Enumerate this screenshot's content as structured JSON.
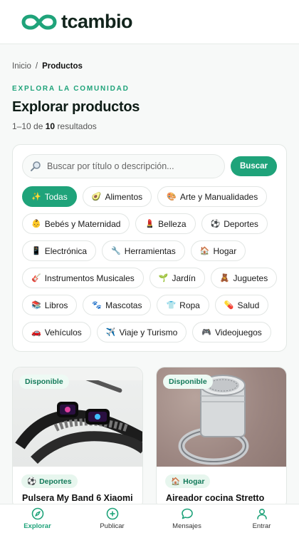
{
  "brand": {
    "name": "tcambio",
    "color": "#1fa37a"
  },
  "breadcrumb": {
    "home": "Inicio",
    "separator": "/",
    "current": "Productos"
  },
  "header": {
    "kicker": "EXPLORA LA COMUNIDAD",
    "title": "Explorar productos",
    "results_range": "1–10 de",
    "results_count": "10",
    "results_suffix": "resultados"
  },
  "search": {
    "placeholder": "Buscar por título o descripción...",
    "value": "",
    "button_label": "Buscar",
    "icon": "search-icon"
  },
  "categories": [
    {
      "emoji": "✨",
      "label": "Todas",
      "active": true
    },
    {
      "emoji": "🥑",
      "label": "Alimentos"
    },
    {
      "emoji": "🎨",
      "label": "Arte y Manualidades"
    },
    {
      "emoji": "👶",
      "label": "Bebés y Maternidad"
    },
    {
      "emoji": "💄",
      "label": "Belleza"
    },
    {
      "emoji": "⚽",
      "label": "Deportes"
    },
    {
      "emoji": "📱",
      "label": "Electrónica"
    },
    {
      "emoji": "🔧",
      "label": "Herramientas"
    },
    {
      "emoji": "🏠",
      "label": "Hogar"
    },
    {
      "emoji": "🎸",
      "label": "Instrumentos Musicales"
    },
    {
      "emoji": "🌱",
      "label": "Jardín"
    },
    {
      "emoji": "🧸",
      "label": "Juguetes"
    },
    {
      "emoji": "📚",
      "label": "Libros"
    },
    {
      "emoji": "🐾",
      "label": "Mascotas"
    },
    {
      "emoji": "👕",
      "label": "Ropa"
    },
    {
      "emoji": "💊",
      "label": "Salud"
    },
    {
      "emoji": "🚗",
      "label": "Vehículos"
    },
    {
      "emoji": "✈️",
      "label": "Viaje y Turismo"
    },
    {
      "emoji": "🎮",
      "label": "Videojuegos"
    }
  ],
  "products": [
    {
      "badge": "Disponible",
      "category_emoji": "⚽",
      "category": "Deportes",
      "title": "Pulsera My Band 6 Xiaomi"
    },
    {
      "badge": "Disponible",
      "category_emoji": "🏠",
      "category": "Hogar",
      "title": "Aireador cocina Stretto"
    }
  ],
  "nav": [
    {
      "label": "Explorar",
      "icon": "compass-icon",
      "active": true
    },
    {
      "label": "Publicar",
      "icon": "plus-circle-icon"
    },
    {
      "label": "Mensajes",
      "icon": "chat-bubble-icon"
    },
    {
      "label": "Entrar",
      "icon": "user-icon"
    }
  ]
}
